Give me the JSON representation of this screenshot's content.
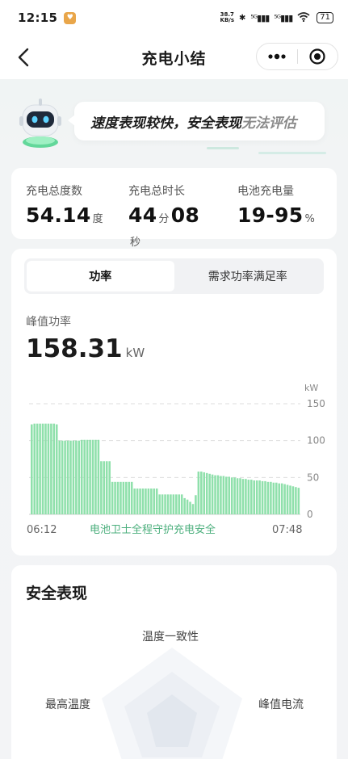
{
  "status_bar": {
    "time": "12:15",
    "speed_value": "38.7",
    "speed_unit": "KB/s",
    "battery": "71"
  },
  "navbar": {
    "title": "充电小结",
    "more_icon": "more-dots-icon",
    "close_icon": "target-close-icon"
  },
  "hero": {
    "summary_main": "速度表现较快，安全表现",
    "summary_gray": "无法评估"
  },
  "stats": {
    "energy": {
      "label": "充电总度数",
      "value": "54.14",
      "unit": "度"
    },
    "duration": {
      "label": "充电总时长",
      "minutes": "44",
      "min_unit": "分",
      "seconds": "08",
      "sec_unit": "秒"
    },
    "battery": {
      "label": "电池充电量",
      "value": "19-95",
      "unit": "%"
    }
  },
  "power": {
    "tabs": [
      {
        "label": "功率",
        "active": true
      },
      {
        "label": "需求功率满足率",
        "active": false
      }
    ],
    "peak_label": "峰值功率",
    "peak_value": "158.31",
    "peak_unit": "kW"
  },
  "chart_data": {
    "type": "bar",
    "unit_label": "kW",
    "y_ticks": [
      150,
      100,
      50,
      0
    ],
    "ylim": [
      0,
      150
    ],
    "x_start_label": "06:12",
    "x_end_label": "07:48",
    "caption": "电池卫士全程守护充电安全",
    "bar_color": "#8fe0ab",
    "values": [
      122,
      123,
      123,
      123,
      123,
      123,
      123,
      123,
      123,
      122,
      100,
      100,
      100,
      100,
      100,
      100,
      100,
      100,
      101,
      101,
      101,
      101,
      101,
      101,
      101,
      72,
      72,
      72,
      72,
      44,
      44,
      44,
      44,
      44,
      44,
      44,
      44,
      35,
      35,
      35,
      35,
      35,
      35,
      35,
      35,
      35,
      27,
      27,
      27,
      27,
      27,
      27,
      27,
      27,
      27,
      22,
      20,
      17,
      14,
      26,
      58,
      58,
      57,
      56,
      55,
      54,
      53,
      53,
      52,
      52,
      51,
      51,
      50,
      50,
      49,
      49,
      48,
      48,
      47,
      47,
      46,
      46,
      46,
      45,
      45,
      44,
      44,
      43,
      43,
      42,
      42,
      41,
      40,
      39,
      38,
      37,
      36
    ],
    "grid": true
  },
  "safety": {
    "title": "安全表现",
    "axes": [
      "温度一致性",
      "峰值电流",
      "最高温度"
    ]
  }
}
